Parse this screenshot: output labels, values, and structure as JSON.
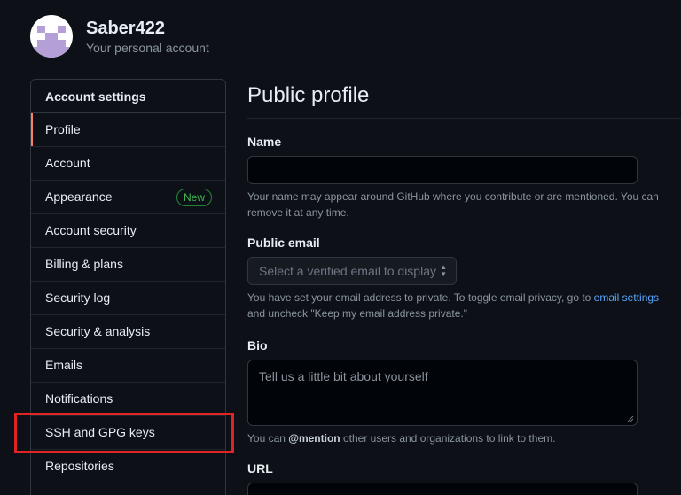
{
  "account": {
    "name": "Saber422",
    "subtitle": "Your personal account"
  },
  "sidebar": {
    "heading": "Account settings",
    "items": [
      {
        "label": "Profile"
      },
      {
        "label": "Account"
      },
      {
        "label": "Appearance",
        "badge": "New"
      },
      {
        "label": "Account security"
      },
      {
        "label": "Billing & plans"
      },
      {
        "label": "Security log"
      },
      {
        "label": "Security & analysis"
      },
      {
        "label": "Emails"
      },
      {
        "label": "Notifications"
      },
      {
        "label": "SSH and GPG keys"
      },
      {
        "label": "Repositories"
      }
    ]
  },
  "main": {
    "title": "Public profile",
    "name": {
      "label": "Name",
      "value": "",
      "note": "Your name may appear around GitHub where you contribute or are mentioned. You can remove it at any time."
    },
    "public_email": {
      "label": "Public email",
      "selected": "Select a verified email to display",
      "note_before": "You have set your email address to private. To toggle email privacy, go to ",
      "note_link": "email settings",
      "note_after": "and uncheck \"Keep my email address private.\""
    },
    "bio": {
      "label": "Bio",
      "placeholder": "Tell us a little bit about yourself",
      "note_before": "You can ",
      "note_mention": "@mention",
      "note_after": " other users and organizations to link to them."
    },
    "url": {
      "label": "URL"
    }
  },
  "colors": {
    "background": "#0d1117",
    "border": "#30363d",
    "accent_selected": "#f78166",
    "link": "#58a6ff",
    "badge_green": "#3fb950",
    "highlight_red": "#e02424"
  }
}
